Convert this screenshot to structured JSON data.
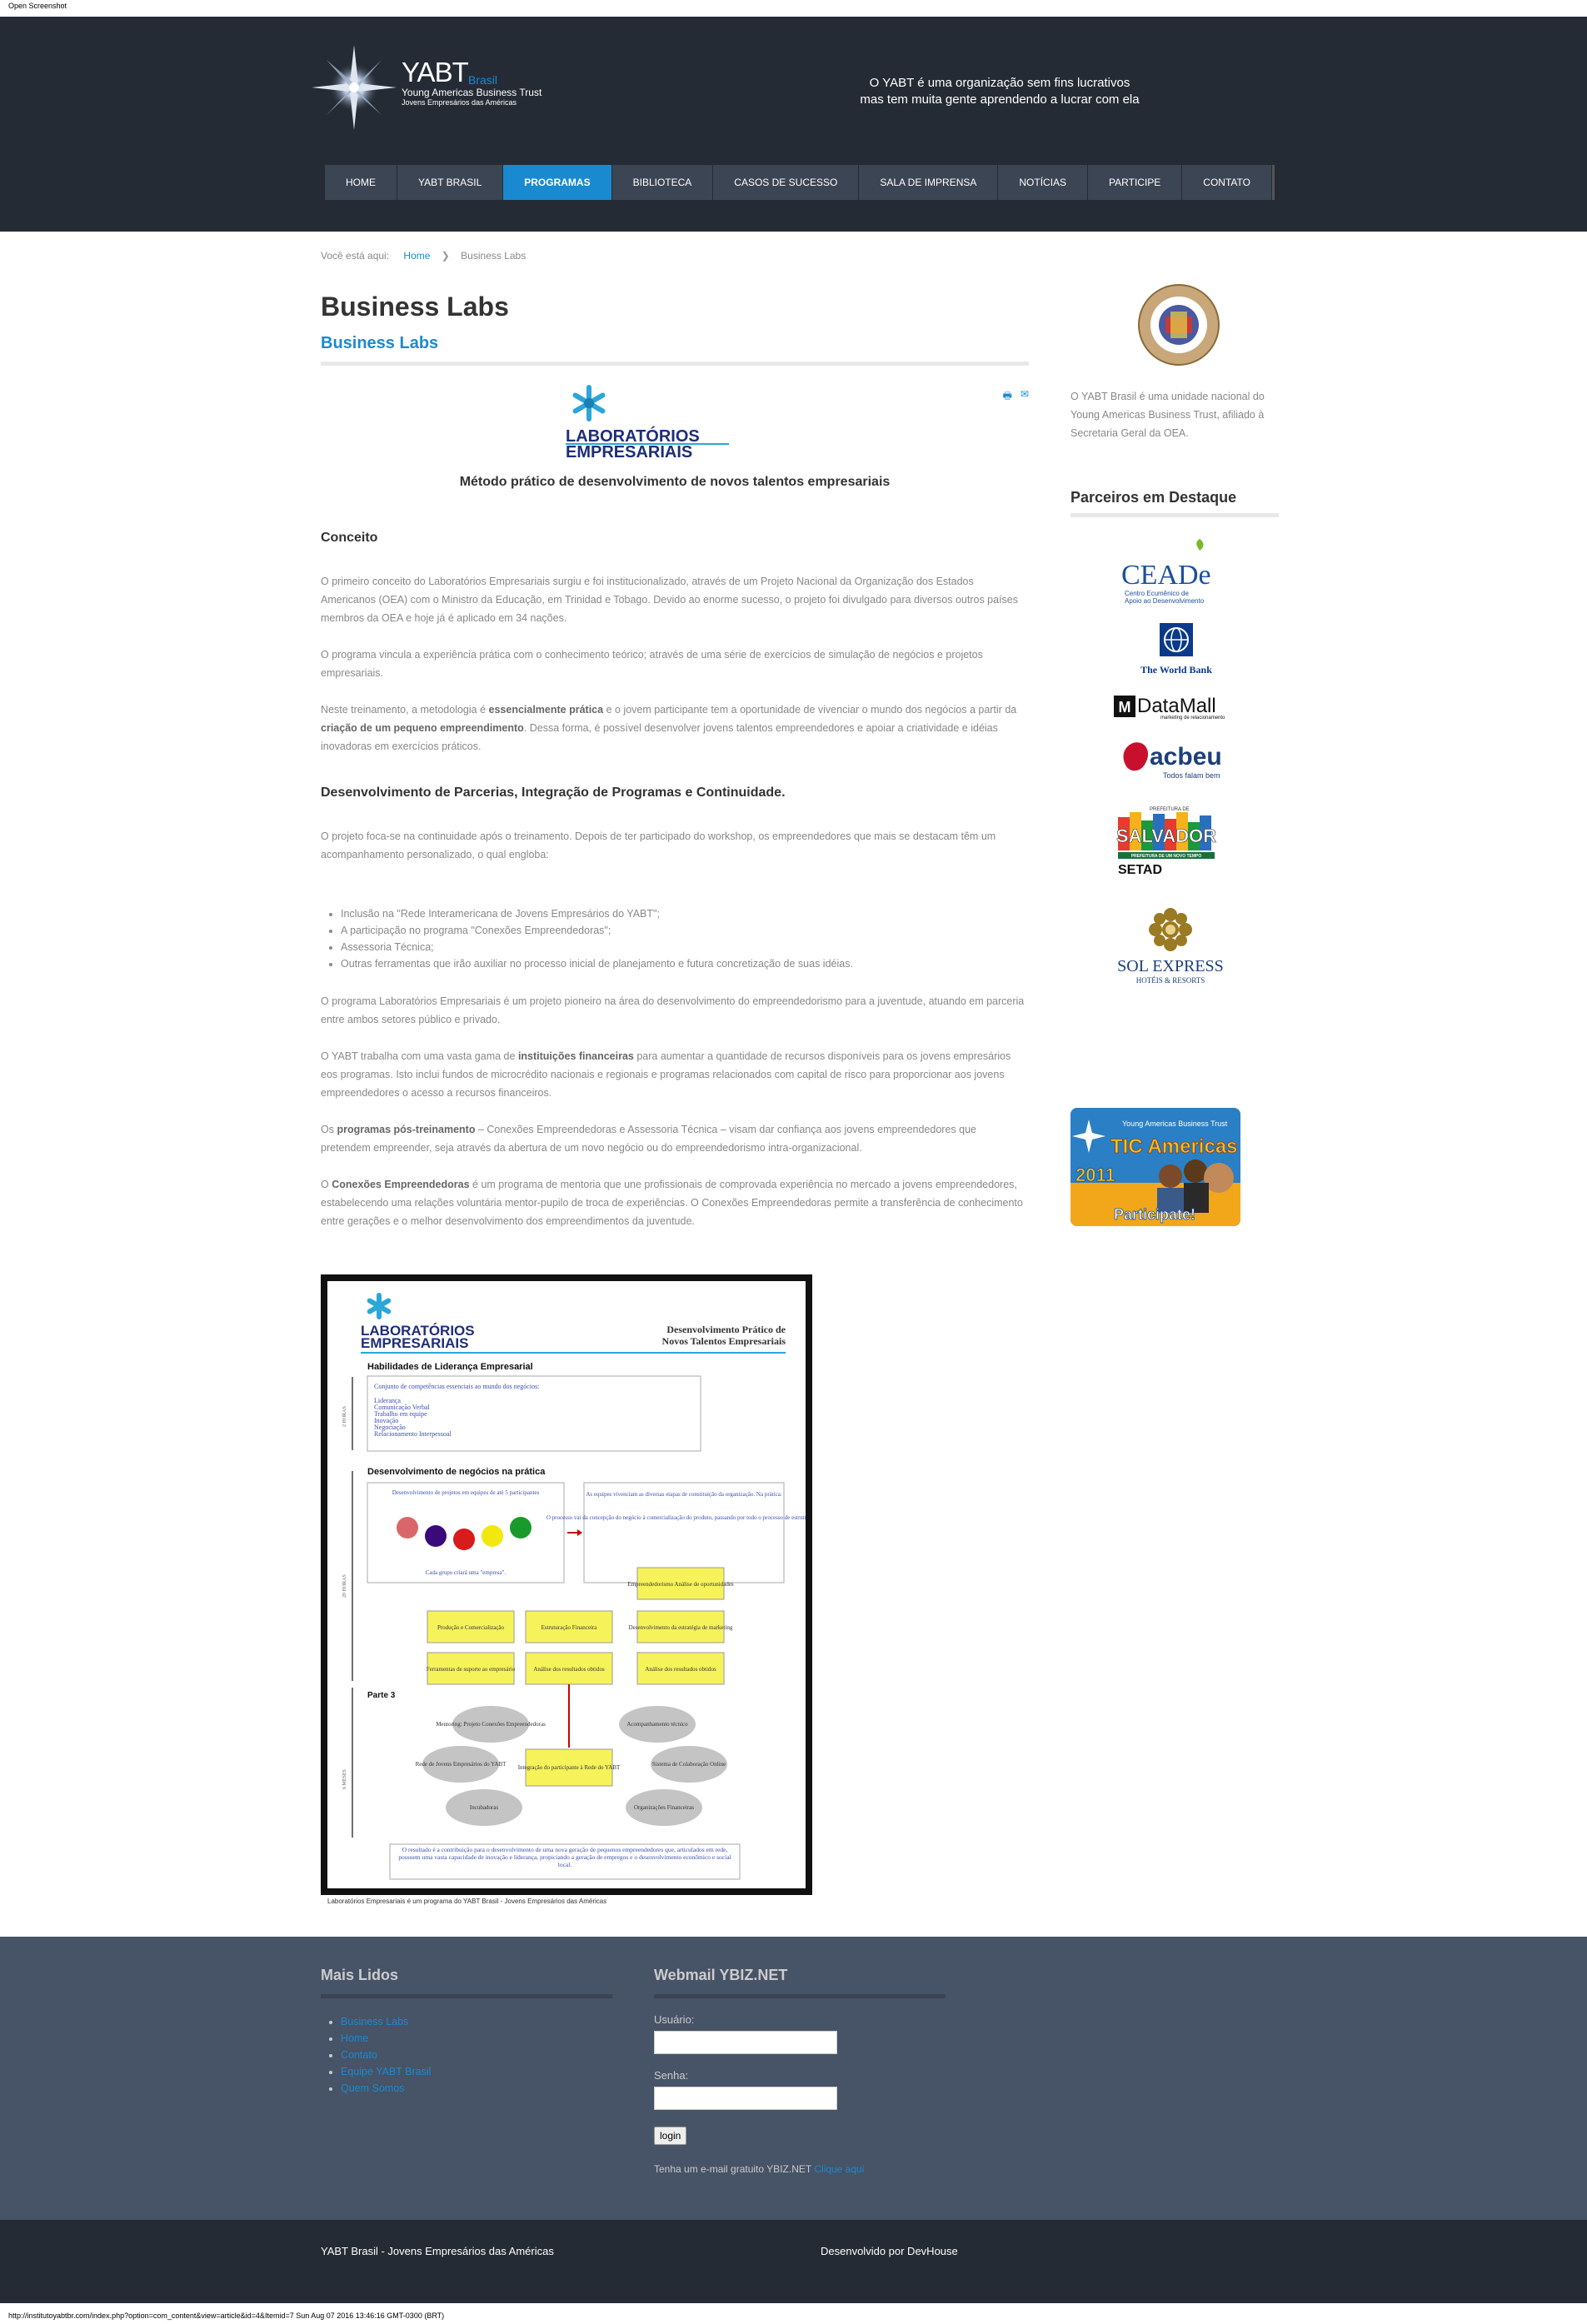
{
  "browser": {
    "top_label": "Open Screenshot",
    "status_line": "http://institutoyabtbr.com/index.php?option=com_content&view=article&id=4&Itemid=7 Sun Aug 07 2016 13:46:16 GMT-0300 (BRT)"
  },
  "header": {
    "logo": {
      "name": "YABT",
      "country": "Brasil",
      "line1": "Young Americas Business Trust",
      "line2": "Jovens Empresários das Américas"
    },
    "tagline_line1": "O YABT é uma organização sem fins lucrativos",
    "tagline_line2": "mas tem muita gente aprendendo a lucrar com ela"
  },
  "nav": [
    "HOME",
    "YABT BRASIL",
    "PROGRAMAS",
    "BIBLIOTECA",
    "CASOS DE SUCESSO",
    "SALA DE IMPRENSA",
    "NOTÍCIAS",
    "PARTICIPE",
    "CONTATO"
  ],
  "nav_active": "PROGRAMAS",
  "breadcrumb": {
    "label": "Você está aqui:",
    "home": "Home",
    "current": "Business Labs"
  },
  "page": {
    "title": "Business Labs",
    "article_title": "Business Labs",
    "logo_line1": "LABORATÓRIOS",
    "logo_line2": "EMPRESARIAIS",
    "method_title": "Método prático de desenvolvimento de novos talentos empresariais",
    "section1": "Conceito",
    "p1": "O primeiro conceito do Laboratórios Empresariais surgiu e foi institucionalizado, através de um Projeto Nacional da Organização dos Estados Americanos (OEA) com o Ministro da Educação, em Trinidad e Tobago. Devido ao enorme sucesso, o projeto foi divulgado para diversos outros países membros da OEA e hoje já é aplicado em 34 nações.",
    "p2": "O programa vincula a experiência prática com o conhecimento teórico; através de uma série de exercícios de simulação de negócios e projetos empresariais.",
    "p3a": "Neste treinamento, a metodologia é ",
    "p3b": "essencialmente prática",
    "p3c": " e o jovem participante tem a oportunidade de vivenciar o mundo dos negócios a partir da ",
    "p3d": "criação de um pequeno empreendimento",
    "p3e": ". Dessa forma, é possível desenvolver jovens talentos empreendedores e apoiar a criatividade e idéias inovadoras em exercícios práticos.",
    "section2": "Desenvolvimento de Parcerias, Integração de Programas e Continuidade.",
    "p4": "O projeto foca-se na continuidade após o treinamento. Depois de ter participado do workshop, os empreendedores que mais se destacam têm um acompanhamento personalizado, o qual engloba:",
    "list": [
      "Inclusão na \"Rede Interamericana de Jovens Empresários do YABT\";",
      "A participação no programa \"Conexões Empreendedoras\";",
      "Assessoria Técnica;",
      "Outras ferramentas que irão auxiliar no processo inicial de planejamento e futura concretização de suas idéias."
    ],
    "p5": "O programa Laboratórios Empresariais é um projeto pioneiro na área do desenvolvimento do empreendedorismo para a juventude, atuando em parceria entre ambos setores público e privado.",
    "p6a": "O YABT trabalha com uma vasta gama de ",
    "p6b": "instituições financeiras",
    "p6c": " para aumentar a quantidade de recursos disponíveis para os jovens empresários eos programas. Isto inclui fundos de microcrédito nacionais e regionais e programas relacionados com capital de risco para proporcionar aos jovens empreendedores o acesso a recursos financeiros.",
    "p7a": "Os ",
    "p7b": "programas pós-treinamento",
    "p7c": " – Conexões Empreendedoras e Assessoria Técnica – visam dar confiança aos jovens empreendedores que pretendem empreender, seja através da abertura de um novo negócio ou do empreendedorismo intra-organizacional.",
    "p8a": "O ",
    "p8b": "Conexões Empreendedoras",
    "p8c": " é um programa de mentoria que une profissionais de comprovada experiência no mercado a jovens empreendedores, estabelecendo uma relações voluntária mentor-pupilo de troca de experiências. O Conexões Empreendedoras permite a transferência de conhecimento entre gerações e o melhor desenvolvimento dos empreendimentos da juventude."
  },
  "diagram": {
    "header_right1": "Desenvolvimento Prático de",
    "header_right2": "Novos Talentos Empresariais",
    "sec1": "Habilidades de Liderança Empresarial",
    "sec1_box_title": "Conjunto de competências essenciais ao mundo dos negócios:",
    "sec1_items": [
      "Liderança",
      "Comunicação Verbal",
      "Trabalho em equipe",
      "Inovação",
      "Negociação",
      "Relacionamento Interpessoal"
    ],
    "left_label1": "2 HORAS",
    "sec2": "Desenvolvimento de negócios na prática",
    "box_a": "Desenvolvimento de projetos em equipes de até 5 participantes",
    "box_a_bottom": "Cada grupo criará uma \"empresa\".",
    "box_b1": "As equipes vivenciam as diversas etapas de constituição da organização. Na prática.",
    "box_b2": "O processo vai da concepção do negócio à comercialização do produto, passando por todo o processo de estruturação.",
    "left_label2": "20 HORAS",
    "y1": "Empreendedorismo Análise de oportunidades",
    "y2": "Produção e Comercialização",
    "y3": "Estruturação Financeira",
    "y4": "Desenvolvimento da estratégia de marketing",
    "y5": "Ferramentas de suporte ao empresário",
    "y6": "Análise dos resultados obtidos",
    "y7": "Análise dos resultados obtidos",
    "sec3": "Parte 3",
    "left_label3": "6 MESES",
    "center": "Integração do participante à Rede do YABT",
    "g1": "Mentoring: Projeto Conexões Empreendedoras",
    "g2": "Acompanhamento técnico",
    "g3": "Rede de Jovens Empresários do YABT",
    "g4": "Sistema de Colaboração Online",
    "g5": "Incubadoras",
    "g6": "Organizações Financeiras",
    "bottom_text": "O resultado é a contribuição para o desenvolvimento de uma nova geração de pequenos empreendedores que, articulados em rede, possuem uma vasta capacidade de inovação e liderança, propiciando a geração de empregos e o desenvolvimento econômico e social local.",
    "caption": "Laboratórios Empresariais é um programa do YABT Brasil - Jovens Empresários das Américas"
  },
  "sidebar": {
    "oas_text": "O YABT Brasil é uma unidade nacional do Young Americas Business Trust, afiliado à Secretaria Geral da OEA.",
    "partners_title": "Parceiros em Destaque",
    "ceade": "CEADe",
    "ceade_sub1": "Centro Ecumênico de",
    "ceade_sub2": "Apoio ao Desenvolvimento",
    "worldbank": "The World Bank",
    "datamall": "DataMall",
    "datamall_sub": "marketing de relacionamento",
    "acbeu": "acbeu",
    "acbeu_sub": "Todos falam bem",
    "salvador_top": "PREFEITURA DE",
    "salvador": "SALVADOR",
    "salvador_sub": "PREFEITURA DE UM NOVO TEMPO",
    "setad": "SETAD",
    "sol": "SOL EXPRESS",
    "sol_sub": "HOTÉIS & RESORTS",
    "tic_top": "Young Americas Business Trust",
    "tic_title": "TIC Americas",
    "tic_year": "2011",
    "tic_cta": "Participate!"
  },
  "footer": {
    "col1_title": "Mais Lidos",
    "col1_links": [
      "Business Labs",
      "Home",
      "Contato",
      "Equipe YABT Brasil",
      "Quem Somos"
    ],
    "col2_title": "Webmail YBIZ.NET",
    "user_label": "Usuário:",
    "pass_label": "Senha:",
    "login": "login",
    "note": "Tenha um e-mail gratuito YBIZ.NET",
    "note_link": "Clique aqui",
    "bottom_left": "YABT Brasil - Jovens Empresários das Américas",
    "bottom_right": "Desenvolvido por DevHouse"
  },
  "colors": {
    "accent": "#1a8ad0",
    "header_bg": "#252b35",
    "footer_bg": "#475366",
    "nav_bg": "#3c4554"
  }
}
